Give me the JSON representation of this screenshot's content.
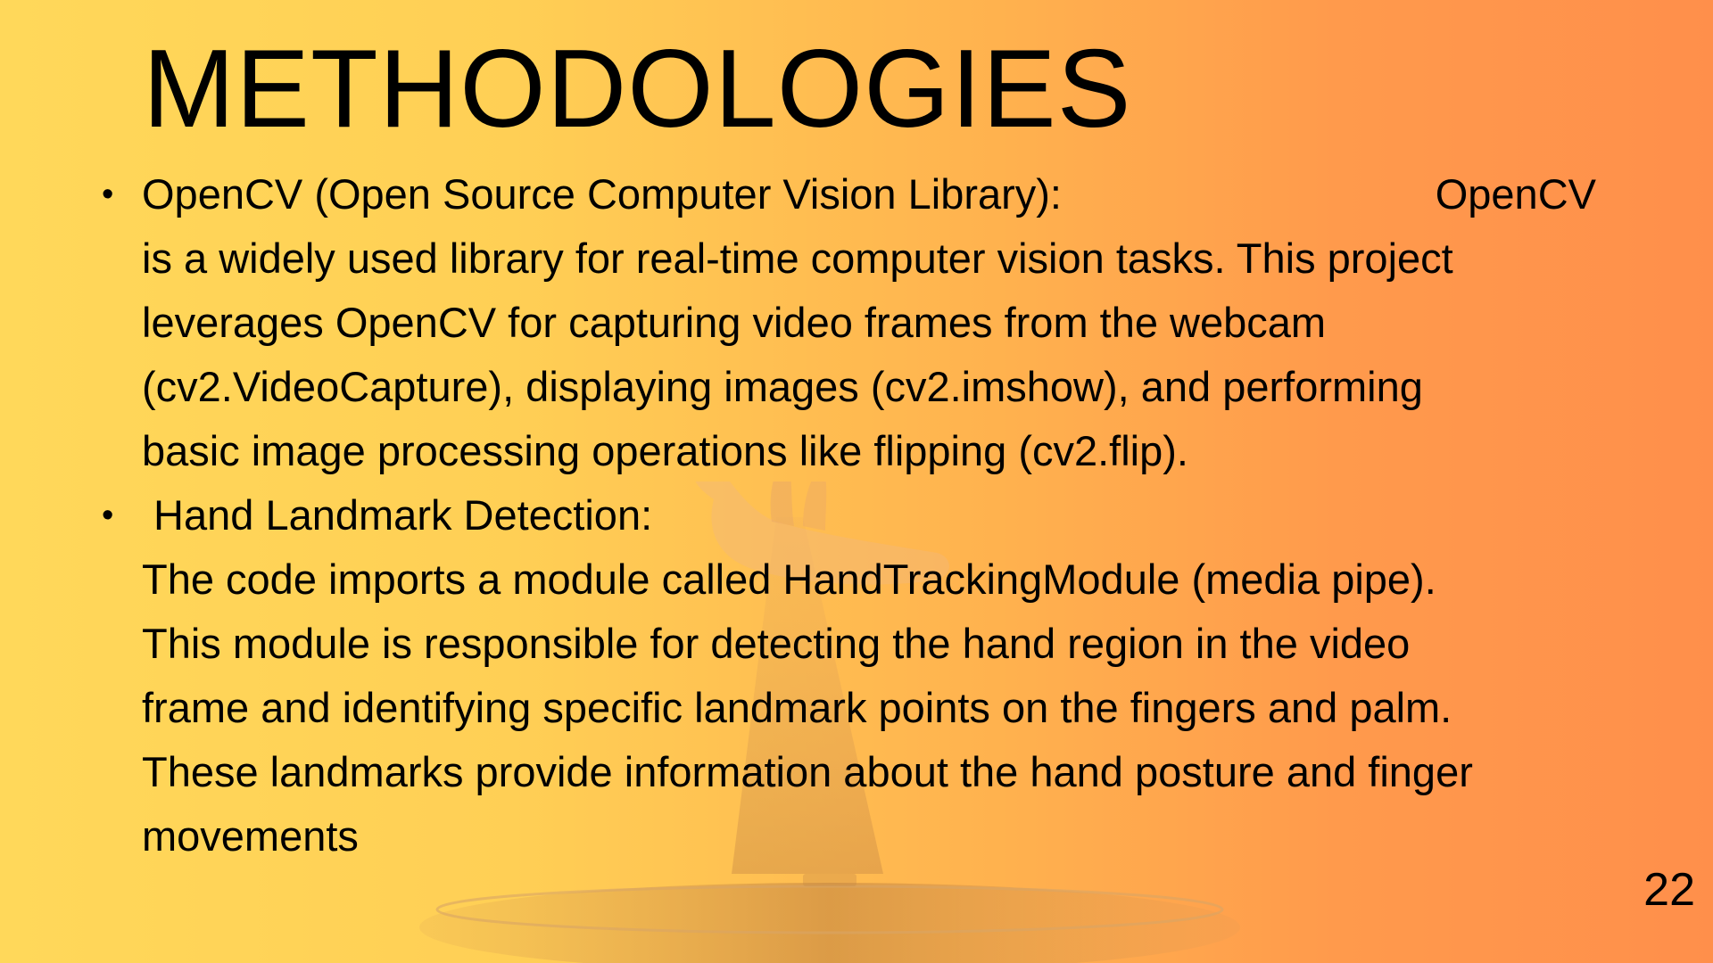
{
  "slide": {
    "title": "METHODOLOGIES",
    "bullets": [
      {
        "heading": "OpenCV (Open Source Computer Vision Library):",
        "heading_tail": "OpenCV",
        "lines": [
          "is a widely used library for real-time computer vision tasks. This project",
          "leverages OpenCV for capturing video frames from the webcam",
          "(cv2.VideoCapture), displaying images (cv2.imshow), and performing",
          "basic image processing operations like flipping (cv2.flip)."
        ]
      },
      {
        "heading": " Hand Landmark Detection:",
        "lines": [
          "The code imports a module called HandTrackingModule (media pipe).",
          "This module is responsible for detecting the hand region in the video",
          "frame and identifying specific landmark points on the fingers and palm.",
          "These landmarks provide information about the hand posture and finger",
          "movements"
        ]
      }
    ],
    "bullet_symbol": "•",
    "page_number": "22"
  },
  "colors": {
    "gradient_left": "#ffd85a",
    "gradient_right": "#ff8f4b",
    "text": "#000000"
  },
  "decorations": {
    "background_art": "hand-on-pedestal-illustration"
  }
}
